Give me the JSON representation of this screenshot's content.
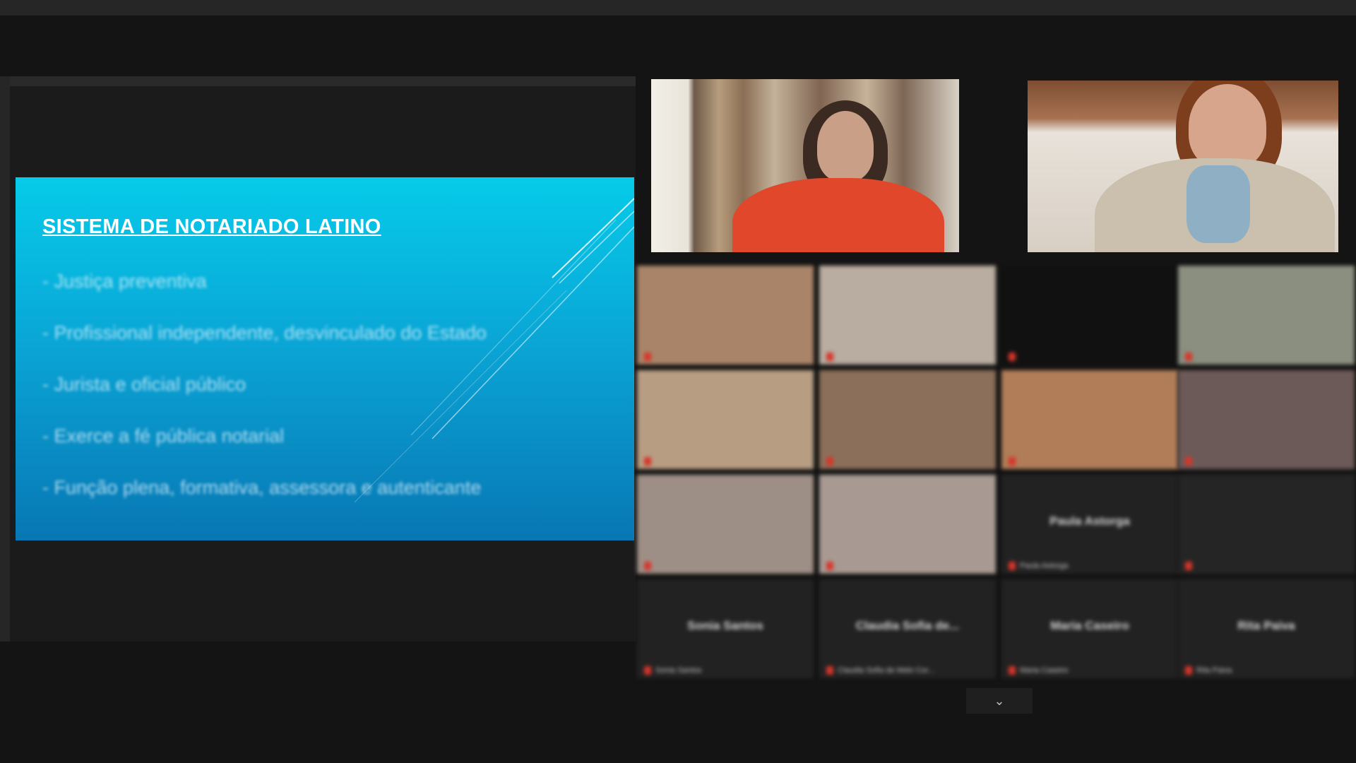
{
  "slide": {
    "title": "SISTEMA DE NOTARIADO LATINO",
    "bullets": [
      "- Justiça preventiva",
      "- Profissional independente, desvinculado do Estado",
      "- Jurista e oficial público",
      "- Exerce a fé pública notarial",
      "- Função plena, formativa, assessora e autenticante"
    ]
  },
  "colors": {
    "slide_top": "#06cbe9",
    "slide_bottom": "#0877b4",
    "background": "#141414",
    "muted_mic": "#d8352a"
  },
  "grid": {
    "tiles": [
      {
        "label": "",
        "center_name": "",
        "bg": "#a98469"
      },
      {
        "label": "",
        "center_name": "",
        "bg": "#b9aca0"
      },
      {
        "label": "",
        "center_name": "",
        "bg": "#111111"
      },
      {
        "label": "",
        "center_name": "",
        "bg": "#8a8f80"
      },
      {
        "label": "",
        "center_name": "",
        "bg": "#b79d82"
      },
      {
        "label": "",
        "center_name": "",
        "bg": "#8b6f5a"
      },
      {
        "label": "",
        "center_name": "",
        "bg": "#b07d58"
      },
      {
        "label": "",
        "center_name": "",
        "bg": "#6c5a58"
      },
      {
        "label": "",
        "center_name": "",
        "bg": "#9e8f86"
      },
      {
        "label": "",
        "center_name": "",
        "bg": "#a89a92"
      },
      {
        "label": "Paula Astorga",
        "center_name": "Paula Astorga",
        "bg": "#222222"
      },
      {
        "label": "",
        "center_name": "",
        "bg": "#252525"
      },
      {
        "label": "Sonia Santos",
        "center_name": "Sonia Santos",
        "bg": "#222222"
      },
      {
        "label": "Claudia Sofia de Melo Cor...",
        "center_name": "Claudia Sofia de...",
        "bg": "#222222"
      },
      {
        "label": "Maria Caseiro",
        "center_name": "Maria Caseiro",
        "bg": "#222222"
      },
      {
        "label": "Rita Paiva",
        "center_name": "Rita Paiva",
        "bg": "#222222"
      }
    ]
  },
  "controls": {
    "scroll_down_icon": "chevron-down-icon",
    "scroll_down_glyph": "⌄"
  }
}
